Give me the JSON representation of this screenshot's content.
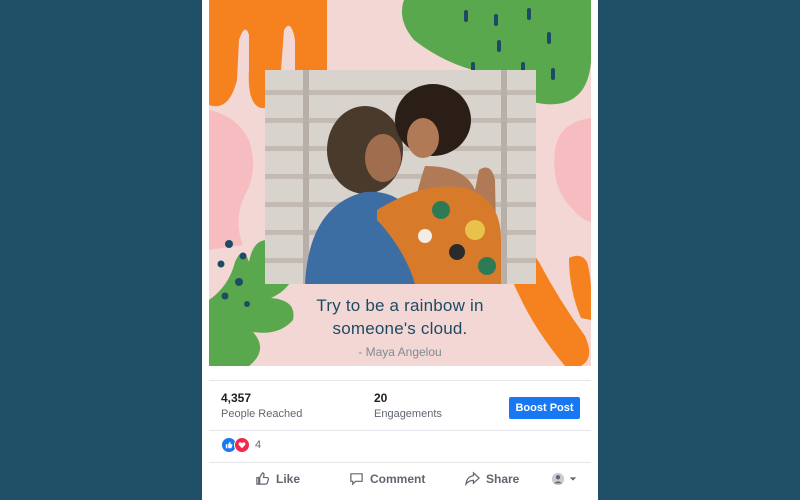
{
  "post": {
    "quote_line1": "Try to be a rainbow in",
    "quote_line2": "someone's cloud.",
    "quote_author": "- Maya Angelou"
  },
  "stats": {
    "reached_value": "4,357",
    "reached_label": "People Reached",
    "engagements_value": "20",
    "engagements_label": "Engagements",
    "boost_label": "Boost Post"
  },
  "reactions": {
    "icons": [
      "like-icon",
      "love-icon"
    ],
    "count": "4"
  },
  "actions": {
    "like_label": "Like",
    "comment_label": "Comment",
    "share_label": "Share"
  },
  "colors": {
    "page_bg": "#1f5068",
    "card_bg": "#ffffff",
    "accent_blue": "#1877f2",
    "love_red": "#f0284a",
    "shape_orange": "#f5821f",
    "shape_green": "#5aa84e",
    "shape_pink": "#f7bcc0",
    "quote_text": "#1d4a64"
  }
}
